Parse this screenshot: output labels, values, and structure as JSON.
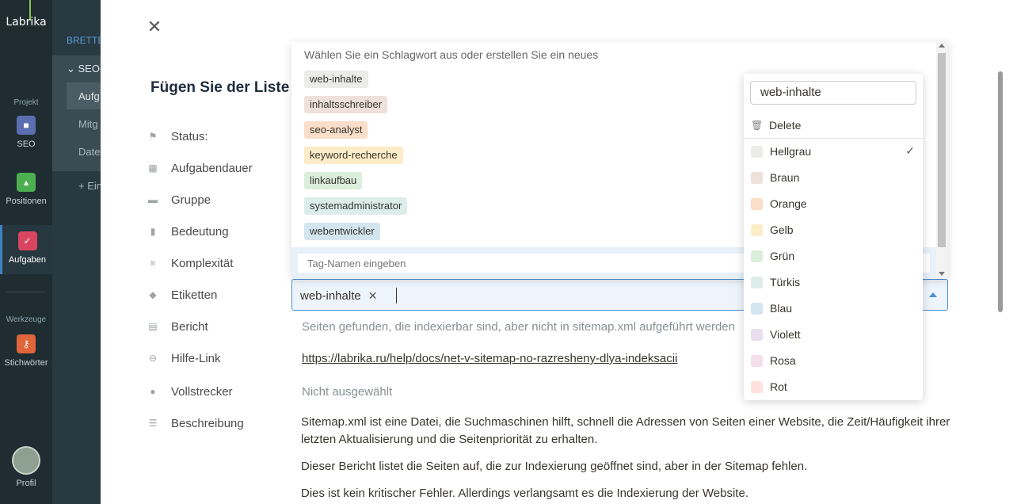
{
  "sidebar": {
    "logo": "Labrika",
    "section_project": "Projekt",
    "section_tools": "Werkzeuge",
    "items": [
      {
        "label": "SEO",
        "color": "#5b6fb0"
      },
      {
        "label": "Positionen",
        "color": "#4caf50"
      },
      {
        "label": "Aufgaben",
        "color": "#d9455f"
      },
      {
        "label": "Stichwörter",
        "color": "#e0653a"
      }
    ],
    "profile_label": "Profil"
  },
  "background_panel": {
    "title": "BRETTE",
    "group": "SEO-",
    "items": [
      "Aufg",
      "Mitg",
      "Date"
    ],
    "add": "+ Ein"
  },
  "modal": {
    "title": "Fügen Sie der Liste v",
    "fields": [
      {
        "label": "Status:",
        "icon": "flag-icon"
      },
      {
        "label": "Aufgabendauer",
        "icon": "calendar-icon"
      },
      {
        "label": "Gruppe",
        "icon": "folder-icon"
      },
      {
        "label": "Bedeutung",
        "icon": "bars-icon"
      },
      {
        "label": "Komplexität",
        "icon": "list-icon"
      },
      {
        "label": "Etiketten",
        "icon": "tag-icon"
      },
      {
        "label": "Bericht",
        "icon": "document-icon"
      },
      {
        "label": "Hilfe-Link",
        "icon": "link-icon"
      },
      {
        "label": "Vollstrecker",
        "icon": "users-icon"
      },
      {
        "label": "Beschreibung",
        "icon": "lines-icon"
      }
    ],
    "report_text": "Seiten gefunden, die indexierbar sind, aber nicht in sitemap.xml aufgeführt werden",
    "help_link": "https://labrika.ru/help/docs/net-v-sitemap-no-razresheny-dlya-indeksacii",
    "executor": "Nicht ausgewählt",
    "description": [
      "Sitemap.xml ist eine Datei, die Suchmaschinen hilft, schnell die Adressen von Seiten einer Website, die Zeit/Häufigkeit ihrer letzten Aktualisierung und die Seitenpriorität zu erhalten.",
      "Dieser Bericht listet die Seiten auf, die zur Indexierung geöffnet sind, aber in der Sitemap fehlen.",
      "Dies ist kein kritischer Fehler. Allerdings verlangsamt es die Indexierung der Website."
    ]
  },
  "tag_select": {
    "selected_chip": "web-inhalte"
  },
  "dropdown": {
    "hint": "Wählen Sie ein Schlagwort aus oder erstellen Sie ein neues",
    "tags": [
      {
        "label": "web-inhalte",
        "color": "#ebebea"
      },
      {
        "label": "inhaltsschreiber",
        "color": "#eee0da"
      },
      {
        "label": "seo-analyst",
        "color": "#fadec9"
      },
      {
        "label": "keyword-recherche",
        "color": "#fdecc8"
      },
      {
        "label": "linkaufbau",
        "color": "#dbeddb"
      },
      {
        "label": "systemadministrator",
        "color": "#ddedea"
      },
      {
        "label": "webentwickler",
        "color": "#d3e5ef"
      }
    ],
    "input_placeholder": "Tag-Namen eingeben"
  },
  "tag_menu": {
    "name_value": "web-inhalte",
    "delete_label": "Delete",
    "selected_color": "Hellgrau",
    "colors": [
      {
        "label": "Hellgrau",
        "swatch": "#ebebea"
      },
      {
        "label": "Braun",
        "swatch": "#eee0da"
      },
      {
        "label": "Orange",
        "swatch": "#fadec9"
      },
      {
        "label": "Gelb",
        "swatch": "#fdecc8"
      },
      {
        "label": "Grün",
        "swatch": "#dbeddb"
      },
      {
        "label": "Türkis",
        "swatch": "#ddedea"
      },
      {
        "label": "Blau",
        "swatch": "#d3e5ef"
      },
      {
        "label": "Violett",
        "swatch": "#e8deee"
      },
      {
        "label": "Rosa",
        "swatch": "#f5e0e9"
      },
      {
        "label": "Rot",
        "swatch": "#ffe2dd"
      }
    ]
  }
}
